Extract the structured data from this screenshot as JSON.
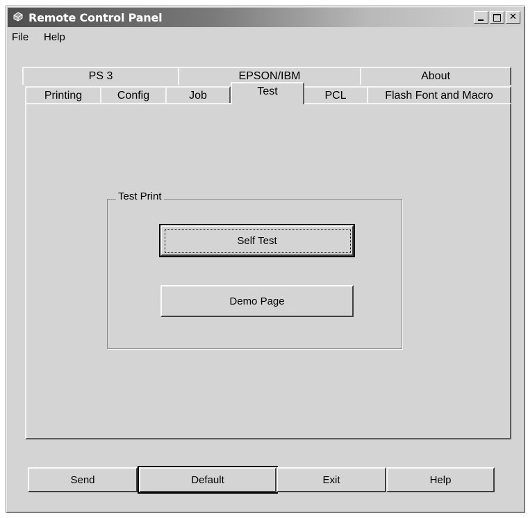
{
  "window": {
    "title": "Remote Control Panel",
    "icon": "printer-icon",
    "controls": {
      "minimize": "minimize-icon",
      "maximize": "maximize-icon",
      "close_glyph": "✕"
    }
  },
  "menu": {
    "file": "File",
    "help": "Help"
  },
  "tabs": {
    "row_back": [
      "PS 3",
      "EPSON/IBM",
      "About"
    ],
    "row_front": [
      "Printing",
      "Config",
      "Job",
      "Test",
      "PCL",
      "Flash Font and Macro"
    ],
    "active": "Test"
  },
  "test_print": {
    "group_label": "Test Print",
    "self_test": "Self Test",
    "demo_page": "Demo Page"
  },
  "footer": {
    "send": "Send",
    "default": "Default",
    "exit": "Exit",
    "help": "Help"
  },
  "colors": {
    "face": "#d4d4d4",
    "title_dark": "#4e4e4e"
  }
}
